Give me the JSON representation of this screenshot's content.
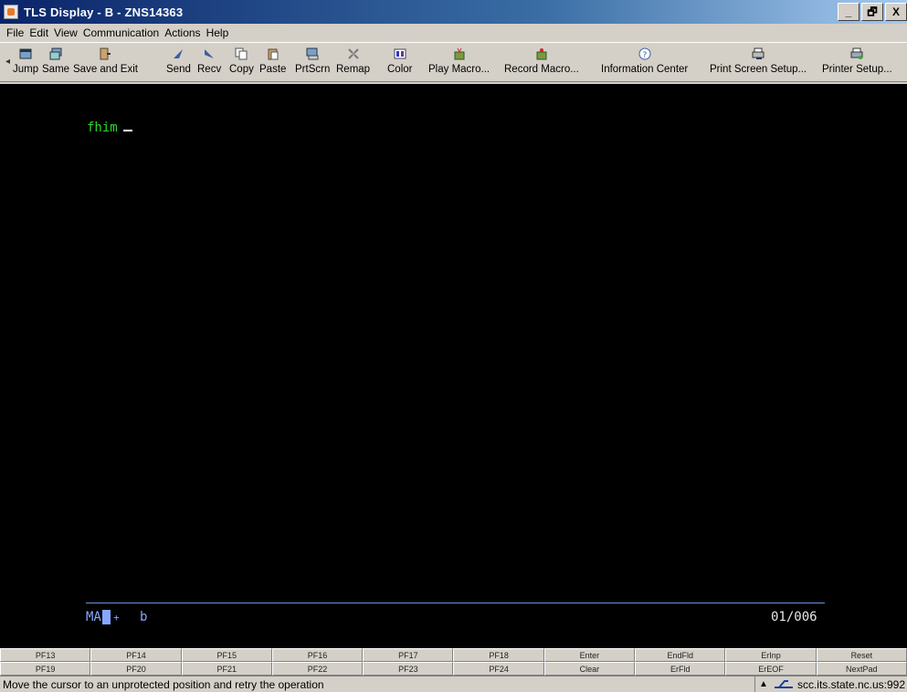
{
  "window": {
    "title": "TLS Display - B - ZNS14363",
    "minimize": "_",
    "maximize": "🗗",
    "close": "X"
  },
  "menu": [
    "File",
    "Edit",
    "View",
    "Communication",
    "Actions",
    "Help"
  ],
  "toolbar": [
    {
      "label": "Jump",
      "icon": "jump-icon"
    },
    {
      "label": "Same",
      "icon": "same-icon"
    },
    {
      "label": "Save and Exit",
      "icon": "save-exit-icon"
    },
    {
      "label": "Send",
      "icon": "send-icon"
    },
    {
      "label": "Recv",
      "icon": "receive-icon"
    },
    {
      "label": "Copy",
      "icon": "copy-icon"
    },
    {
      "label": "Paste",
      "icon": "paste-icon"
    },
    {
      "label": "PrtScrn",
      "icon": "print-screen-icon"
    },
    {
      "label": "Remap",
      "icon": "remap-icon"
    },
    {
      "label": "Color",
      "icon": "color-icon"
    },
    {
      "label": "Play Macro...",
      "icon": "play-macro-icon"
    },
    {
      "label": "Record Macro...",
      "icon": "record-macro-icon"
    },
    {
      "label": "Information Center",
      "icon": "info-center-icon"
    },
    {
      "label": "Print Screen Setup...",
      "icon": "print-setup-icon"
    },
    {
      "label": "Printer Setup...",
      "icon": "printer-setup-icon"
    }
  ],
  "terminal": {
    "command": "fhim",
    "oia_mode": "MA",
    "oia_indicator": "b",
    "oia_arrow": "+",
    "cursor_position": "01/006"
  },
  "keypad": {
    "row1": [
      "PF13",
      "PF14",
      "PF15",
      "PF16",
      "PF17",
      "PF18",
      "Enter",
      "EndFld",
      "ErInp",
      "Reset"
    ],
    "row2": [
      "PF19",
      "PF20",
      "PF21",
      "PF22",
      "PF23",
      "PF24",
      "Clear",
      "ErFld",
      "ErEOF",
      "NextPad"
    ]
  },
  "status": {
    "message": "Move the cursor to an unprotected position and retry the operation",
    "host": "scc.its.state.nc.us:992"
  },
  "colors": {
    "terminal_bg": "#000000",
    "text_green": "#2bd92b",
    "oia_blue": "#87a7ff",
    "title_blue": "#0a246a"
  }
}
